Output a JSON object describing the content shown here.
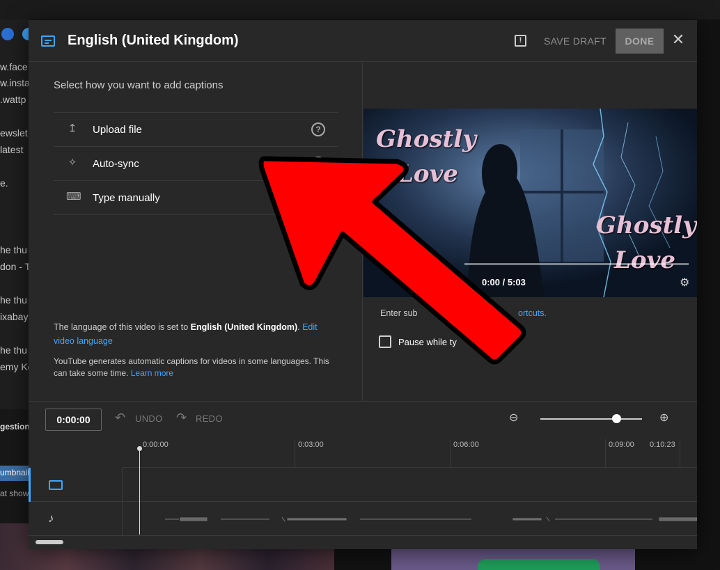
{
  "background": {
    "side_lines": [
      "w.face",
      "w.insta",
      ".wattp",
      "ewslet",
      "latest",
      "e.",
      "he thu",
      "don - Th",
      "he thu",
      "ixabay",
      "he thu",
      "emy Ko"
    ],
    "suggestion_label": "gestion",
    "thumbnail_tag": "umbnail",
    "thumbnail_desc": "at show"
  },
  "modal": {
    "title": "English (United Kingdom)",
    "feedback_glyph": "!",
    "save_draft": "SAVE DRAFT",
    "done": "DONE",
    "close_glyph": "✕"
  },
  "left": {
    "prompt": "Select how you want to add captions",
    "options": [
      {
        "label": "Upload file",
        "help": "?"
      },
      {
        "label": "Auto-sync",
        "help": "?"
      },
      {
        "label": "Type manually"
      }
    ],
    "lang_prefix": "The language of this video is set to ",
    "lang_value": "English (United Kingdom)",
    "lang_suffix": ". ",
    "edit_link": "Edit video language",
    "auto_text": "YouTube generates automatic captions for videos in some languages. This can take some time. ",
    "learn_more": "Learn more"
  },
  "right": {
    "video_title_1": "Ghostly",
    "video_title_2": "Love",
    "time": "0:00 / 5:03",
    "enter_note": "Enter sub",
    "shortcuts_link": "ortcuts.",
    "pause_label": "Pause while ty"
  },
  "timeline": {
    "current_time": "0:00:00",
    "undo": "UNDO",
    "redo": "REDO",
    "ticks": [
      "0:00:00",
      "0:03:00",
      "0:06:00",
      "0:09:00",
      "0:10:23"
    ]
  },
  "colors": {
    "accent": "#3ea6ff",
    "arrow": "#ff0000"
  }
}
